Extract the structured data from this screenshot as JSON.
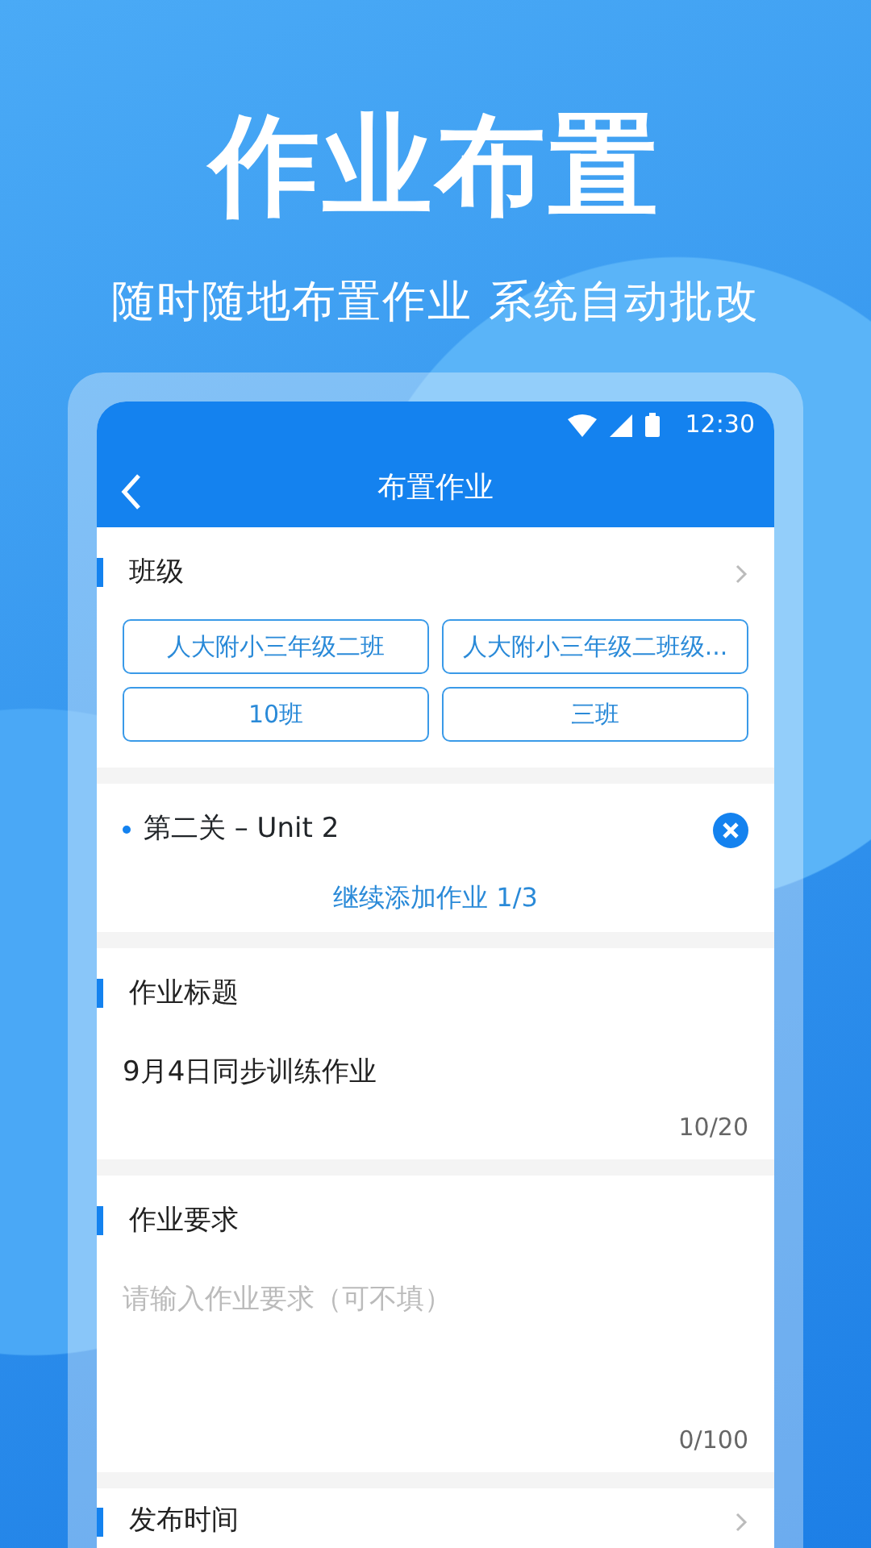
{
  "hero": {
    "title": "作业布置",
    "subtitle": "随时随地布置作业 系统自动批改"
  },
  "status_bar": {
    "time": "12:30"
  },
  "nav": {
    "title": "布置作业"
  },
  "class_section": {
    "title": "班级",
    "chips": [
      "人大附小三年级二班",
      "人大附小三年级二班级...",
      "10班",
      "三班"
    ]
  },
  "assignments": [
    {
      "label": "第二关 – Unit 2"
    }
  ],
  "add_more": "继续添加作业 1/3",
  "title_section": {
    "title": "作业标题",
    "value": "9月4日同步训练作业",
    "counter": "10/20"
  },
  "requirement_section": {
    "title": "作业要求",
    "placeholder": "请输入作业要求（可不填）",
    "counter": "0/100"
  },
  "publish_section": {
    "title": "发布时间"
  }
}
